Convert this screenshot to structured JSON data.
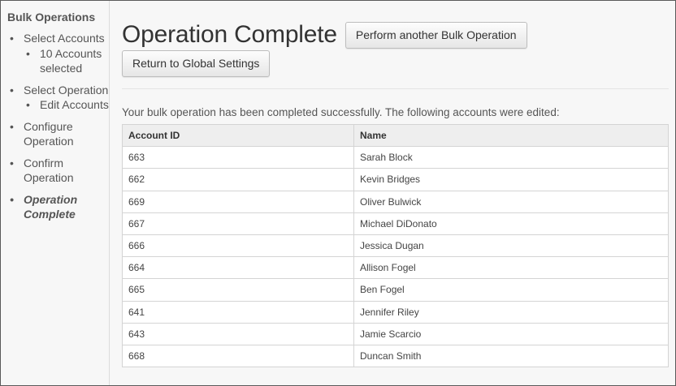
{
  "sidebar": {
    "title": "Bulk Operations",
    "steps": [
      {
        "label": "Select Accounts",
        "sub": "10 Accounts selected"
      },
      {
        "label": "Select Operation",
        "sub": "Edit Accounts"
      },
      {
        "label": "Configure Operation"
      },
      {
        "label": "Confirm Operation"
      },
      {
        "label": "Operation Complete"
      }
    ]
  },
  "main": {
    "title": "Operation Complete",
    "another_button": "Perform another Bulk Operation",
    "return_button": "Return to Global Settings",
    "message": "Your bulk operation has been completed successfully. The following accounts were edited:",
    "table": {
      "headers": [
        "Account ID",
        "Name"
      ],
      "rows": [
        [
          "663",
          "Sarah Block"
        ],
        [
          "662",
          "Kevin Bridges"
        ],
        [
          "669",
          "Oliver Bulwick"
        ],
        [
          "667",
          "Michael DiDonato"
        ],
        [
          "666",
          "Jessica Dugan"
        ],
        [
          "664",
          "Allison Fogel"
        ],
        [
          "665",
          "Ben Fogel"
        ],
        [
          "641",
          "Jennifer Riley"
        ],
        [
          "643",
          "Jamie Scarcio"
        ],
        [
          "668",
          "Duncan Smith"
        ]
      ]
    }
  }
}
